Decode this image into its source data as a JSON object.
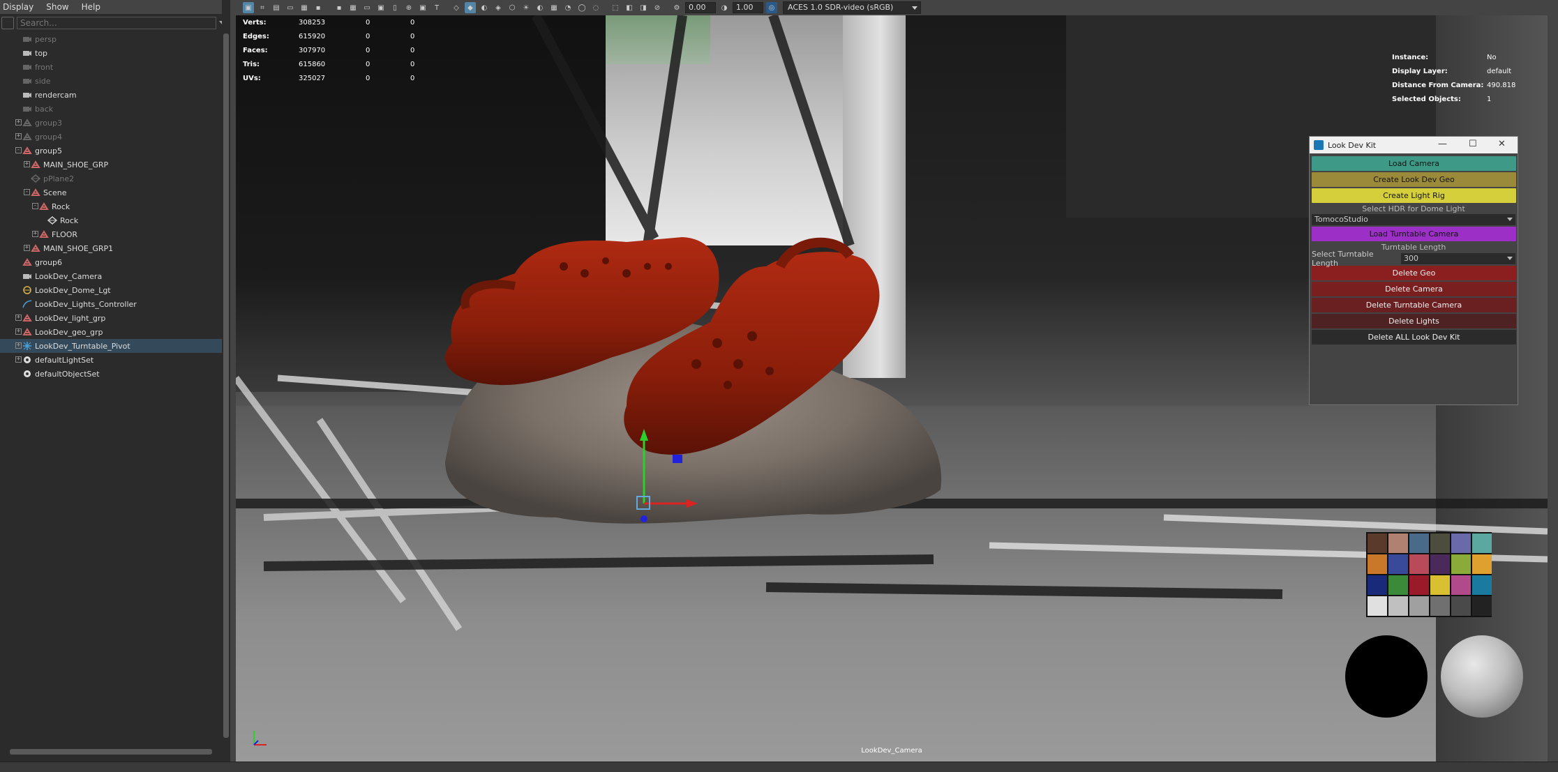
{
  "menu": {
    "display": "Display",
    "show": "Show",
    "help": "Help"
  },
  "search": {
    "placeholder": "Search..."
  },
  "outliner": [
    {
      "label": "persp",
      "indent": 0,
      "icon": "camera-icon",
      "dim": true,
      "exp": ""
    },
    {
      "label": "top",
      "indent": 0,
      "icon": "camera-icon",
      "dim": false,
      "exp": ""
    },
    {
      "label": "front",
      "indent": 0,
      "icon": "camera-icon",
      "dim": true,
      "exp": ""
    },
    {
      "label": "side",
      "indent": 0,
      "icon": "camera-icon",
      "dim": true,
      "exp": ""
    },
    {
      "label": "rendercam",
      "indent": 0,
      "icon": "camera-icon",
      "dim": false,
      "exp": ""
    },
    {
      "label": "back",
      "indent": 0,
      "icon": "camera-icon",
      "dim": true,
      "exp": ""
    },
    {
      "label": "group3",
      "indent": 0,
      "icon": "group-icon",
      "dim": true,
      "exp": "+"
    },
    {
      "label": "group4",
      "indent": 0,
      "icon": "group-icon",
      "dim": true,
      "exp": "+"
    },
    {
      "label": "group5",
      "indent": 0,
      "icon": "group-icon",
      "dim": false,
      "exp": "-"
    },
    {
      "label": "MAIN_SHOE_GRP",
      "indent": 1,
      "icon": "group-icon",
      "dim": false,
      "exp": "+"
    },
    {
      "label": "pPlane2",
      "indent": 1,
      "icon": "mesh-icon",
      "dim": true,
      "exp": ""
    },
    {
      "label": "Scene",
      "indent": 1,
      "icon": "group-icon",
      "dim": false,
      "exp": "-"
    },
    {
      "label": "Rock",
      "indent": 2,
      "icon": "group-icon",
      "dim": false,
      "exp": "-"
    },
    {
      "label": "Rock",
      "indent": 3,
      "icon": "mesh-icon",
      "dim": false,
      "exp": ""
    },
    {
      "label": "FLOOR",
      "indent": 2,
      "icon": "group-icon",
      "dim": false,
      "exp": "+"
    },
    {
      "label": "MAIN_SHOE_GRP1",
      "indent": 1,
      "icon": "group-icon",
      "dim": false,
      "exp": "+"
    },
    {
      "label": "group6",
      "indent": 0,
      "icon": "group-icon",
      "dim": false,
      "exp": ""
    },
    {
      "label": "LookDev_Camera",
      "indent": 0,
      "icon": "camera-icon",
      "dim": false,
      "exp": ""
    },
    {
      "label": "LookDev_Dome_Lgt",
      "indent": 0,
      "icon": "dome-light-icon",
      "dim": false,
      "exp": ""
    },
    {
      "label": "LookDev_Lights_Controller",
      "indent": 0,
      "icon": "curve-icon",
      "dim": false,
      "exp": ""
    },
    {
      "label": "LookDev_light_grp",
      "indent": 0,
      "icon": "group-icon",
      "dim": false,
      "exp": "+"
    },
    {
      "label": "LookDev_geo_grp",
      "indent": 0,
      "icon": "group-icon",
      "dim": false,
      "exp": "+"
    },
    {
      "label": "LookDev_Turntable_Pivot",
      "indent": 0,
      "icon": "locator-icon",
      "dim": false,
      "exp": "+",
      "selected": true
    },
    {
      "label": "defaultLightSet",
      "indent": 0,
      "icon": "set-icon",
      "dim": false,
      "exp": "+"
    },
    {
      "label": "defaultObjectSet",
      "indent": 0,
      "icon": "set-icon",
      "dim": false,
      "exp": ""
    }
  ],
  "toolbar": {
    "exposure": "0.00",
    "gamma": "1.00",
    "colorspace": "ACES 1.0 SDR-video (sRGB)"
  },
  "stats": [
    {
      "k": "Verts:",
      "v": "308253",
      "a": "0",
      "b": "0"
    },
    {
      "k": "Edges:",
      "v": "615920",
      "a": "0",
      "b": "0"
    },
    {
      "k": "Faces:",
      "v": "307970",
      "a": "0",
      "b": "0"
    },
    {
      "k": "Tris:",
      "v": "615860",
      "a": "0",
      "b": "0"
    },
    {
      "k": "UVs:",
      "v": "325027",
      "a": "0",
      "b": "0"
    }
  ],
  "info": [
    {
      "k": "Instance:",
      "v": "No"
    },
    {
      "k": "Display Layer:",
      "v": "default"
    },
    {
      "k": "Distance From Camera:",
      "v": "490.818"
    },
    {
      "k": "Selected Objects:",
      "v": "1"
    }
  ],
  "ldk": {
    "title": "Look Dev Kit",
    "load_camera": "Load Camera",
    "create_geo": "Create Look Dev Geo",
    "create_rig": "Create Light Rig",
    "hdr_label": "Select HDR for Dome Light",
    "hdr_value": "TomocoStudio",
    "load_turntable": "Load Turntable Camera",
    "turntable_label": "Turntable Length",
    "select_length_label": "Select Turntable Length",
    "length_value": "300",
    "delete_geo": "Delete Geo",
    "delete_camera": "Delete Camera",
    "delete_turntable": "Delete Turntable Camera",
    "delete_lights": "Delete Lights",
    "delete_all": "Delete ALL Look Dev Kit",
    "colors": {
      "load_camera": "#3e9a86",
      "create_geo": "#9a8a3a",
      "create_rig": "#d4cf3a",
      "load_turntable": "#9b2fc6",
      "delete_geo": "#8b1f1f",
      "delete_camera": "#7a1f1f",
      "delete_turntable": "#6a2020",
      "delete_lights": "#4e2222",
      "delete_all": "#2b2b2b"
    }
  },
  "checker_colors": [
    "#5a3a2a",
    "#b08070",
    "#4a6a8a",
    "#4d4d3d",
    "#6a6aaa",
    "#5aa8a0",
    "#c87828",
    "#3a4a9a",
    "#b84a5a",
    "#4a2a5a",
    "#8aaa3a",
    "#e0a030",
    "#1a2a7a",
    "#3a8a3a",
    "#9a1a2a",
    "#d8c030",
    "#b04a8a",
    "#1a7aa0",
    "#e0e0e0",
    "#c0c0c0",
    "#a0a0a0",
    "#707070",
    "#4a4a4a",
    "#222222"
  ],
  "viewport": {
    "camera_label": "LookDev_Camera"
  }
}
